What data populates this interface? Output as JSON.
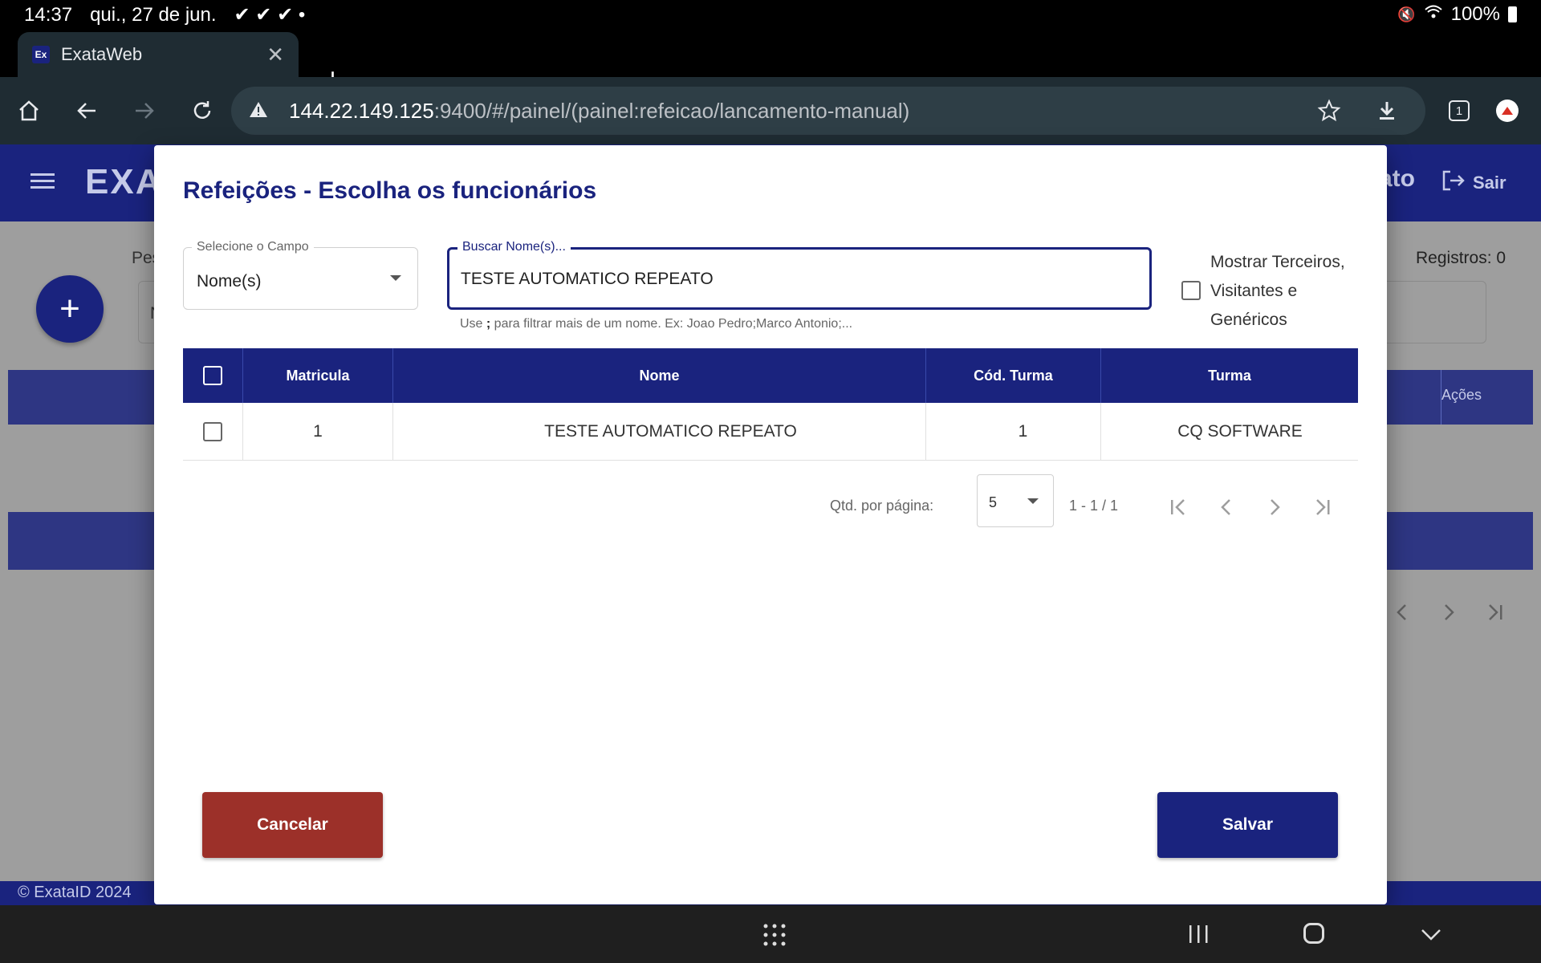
{
  "status_bar": {
    "time": "14:37",
    "date": "qui., 27 de jun.",
    "battery": "100%"
  },
  "browser": {
    "tab_title": "ExataWeb",
    "favicon_text": "Ex",
    "url_host": "144.22.149.125",
    "url_path": ":9400/#/painel/(painel:refeicao/lancamento-manual)",
    "tab_count": "1"
  },
  "app": {
    "logo_text": "EXA",
    "user_partial": "ato",
    "logout_label": "Sair",
    "bg_search_label": "Pes",
    "bg_field_char": "N",
    "registros": "Registros: 0",
    "acoes": "Ações",
    "footer": "© ExataID 2024"
  },
  "modal": {
    "title": "Refeições - Escolha os funcionários",
    "select_field": {
      "label": "Selecione o Campo",
      "value": "Nome(s)"
    },
    "search_field": {
      "label": "Buscar Nome(s)...",
      "value": "TESTE AUTOMATICO REPEATO"
    },
    "search_hint_pre": "Use ",
    "search_hint_bold": ";",
    "search_hint_post": " para filtrar mais de um nome. Ex: Joao Pedro;Marco Antonio;...",
    "show_third_party_label": "Mostrar Terceiros, Visitantes e Genéricos",
    "table": {
      "headers": [
        "Matricula",
        "Nome",
        "Cód. Turma",
        "Turma"
      ],
      "rows": [
        {
          "matricula": "1",
          "nome": "TESTE AUTOMATICO REPEATO",
          "cod_turma": "1",
          "turma": "CQ SOFTWARE"
        }
      ]
    },
    "paginator": {
      "label": "Qtd. por página:",
      "page_size": "5",
      "range": "1 - 1 / 1"
    },
    "cancel_label": "Cancelar",
    "save_label": "Salvar"
  },
  "colors": {
    "primary": "#1a237e",
    "danger": "#9c3029"
  }
}
